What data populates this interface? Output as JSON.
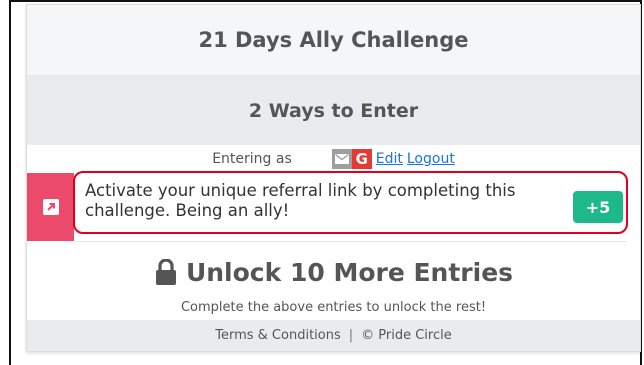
{
  "widget": {
    "title": "21 Days Ally Challenge",
    "ways": "2 Ways to Enter",
    "entering_as": "Entering as",
    "g_letter": "G",
    "edit_label": "Edit",
    "logout_label": "Logout",
    "entry": {
      "text": "Activate your unique referral link by completing this challenge. Being an ally!",
      "points": "+5",
      "icon": "external-link-icon"
    },
    "unlock_title": "Unlock 10 More Entries",
    "unlock_sub": "Complete the above entries to unlock the rest!",
    "footer": {
      "terms": "Terms & Conditions",
      "separator": "|",
      "copyright": "© Pride Circle"
    }
  },
  "colors": {
    "entry_icon_bg": "#ec4a6b",
    "badge_bg": "#1db98a",
    "highlight": "#e0001b",
    "google_red": "#e53935",
    "link": "#1a73e8"
  }
}
